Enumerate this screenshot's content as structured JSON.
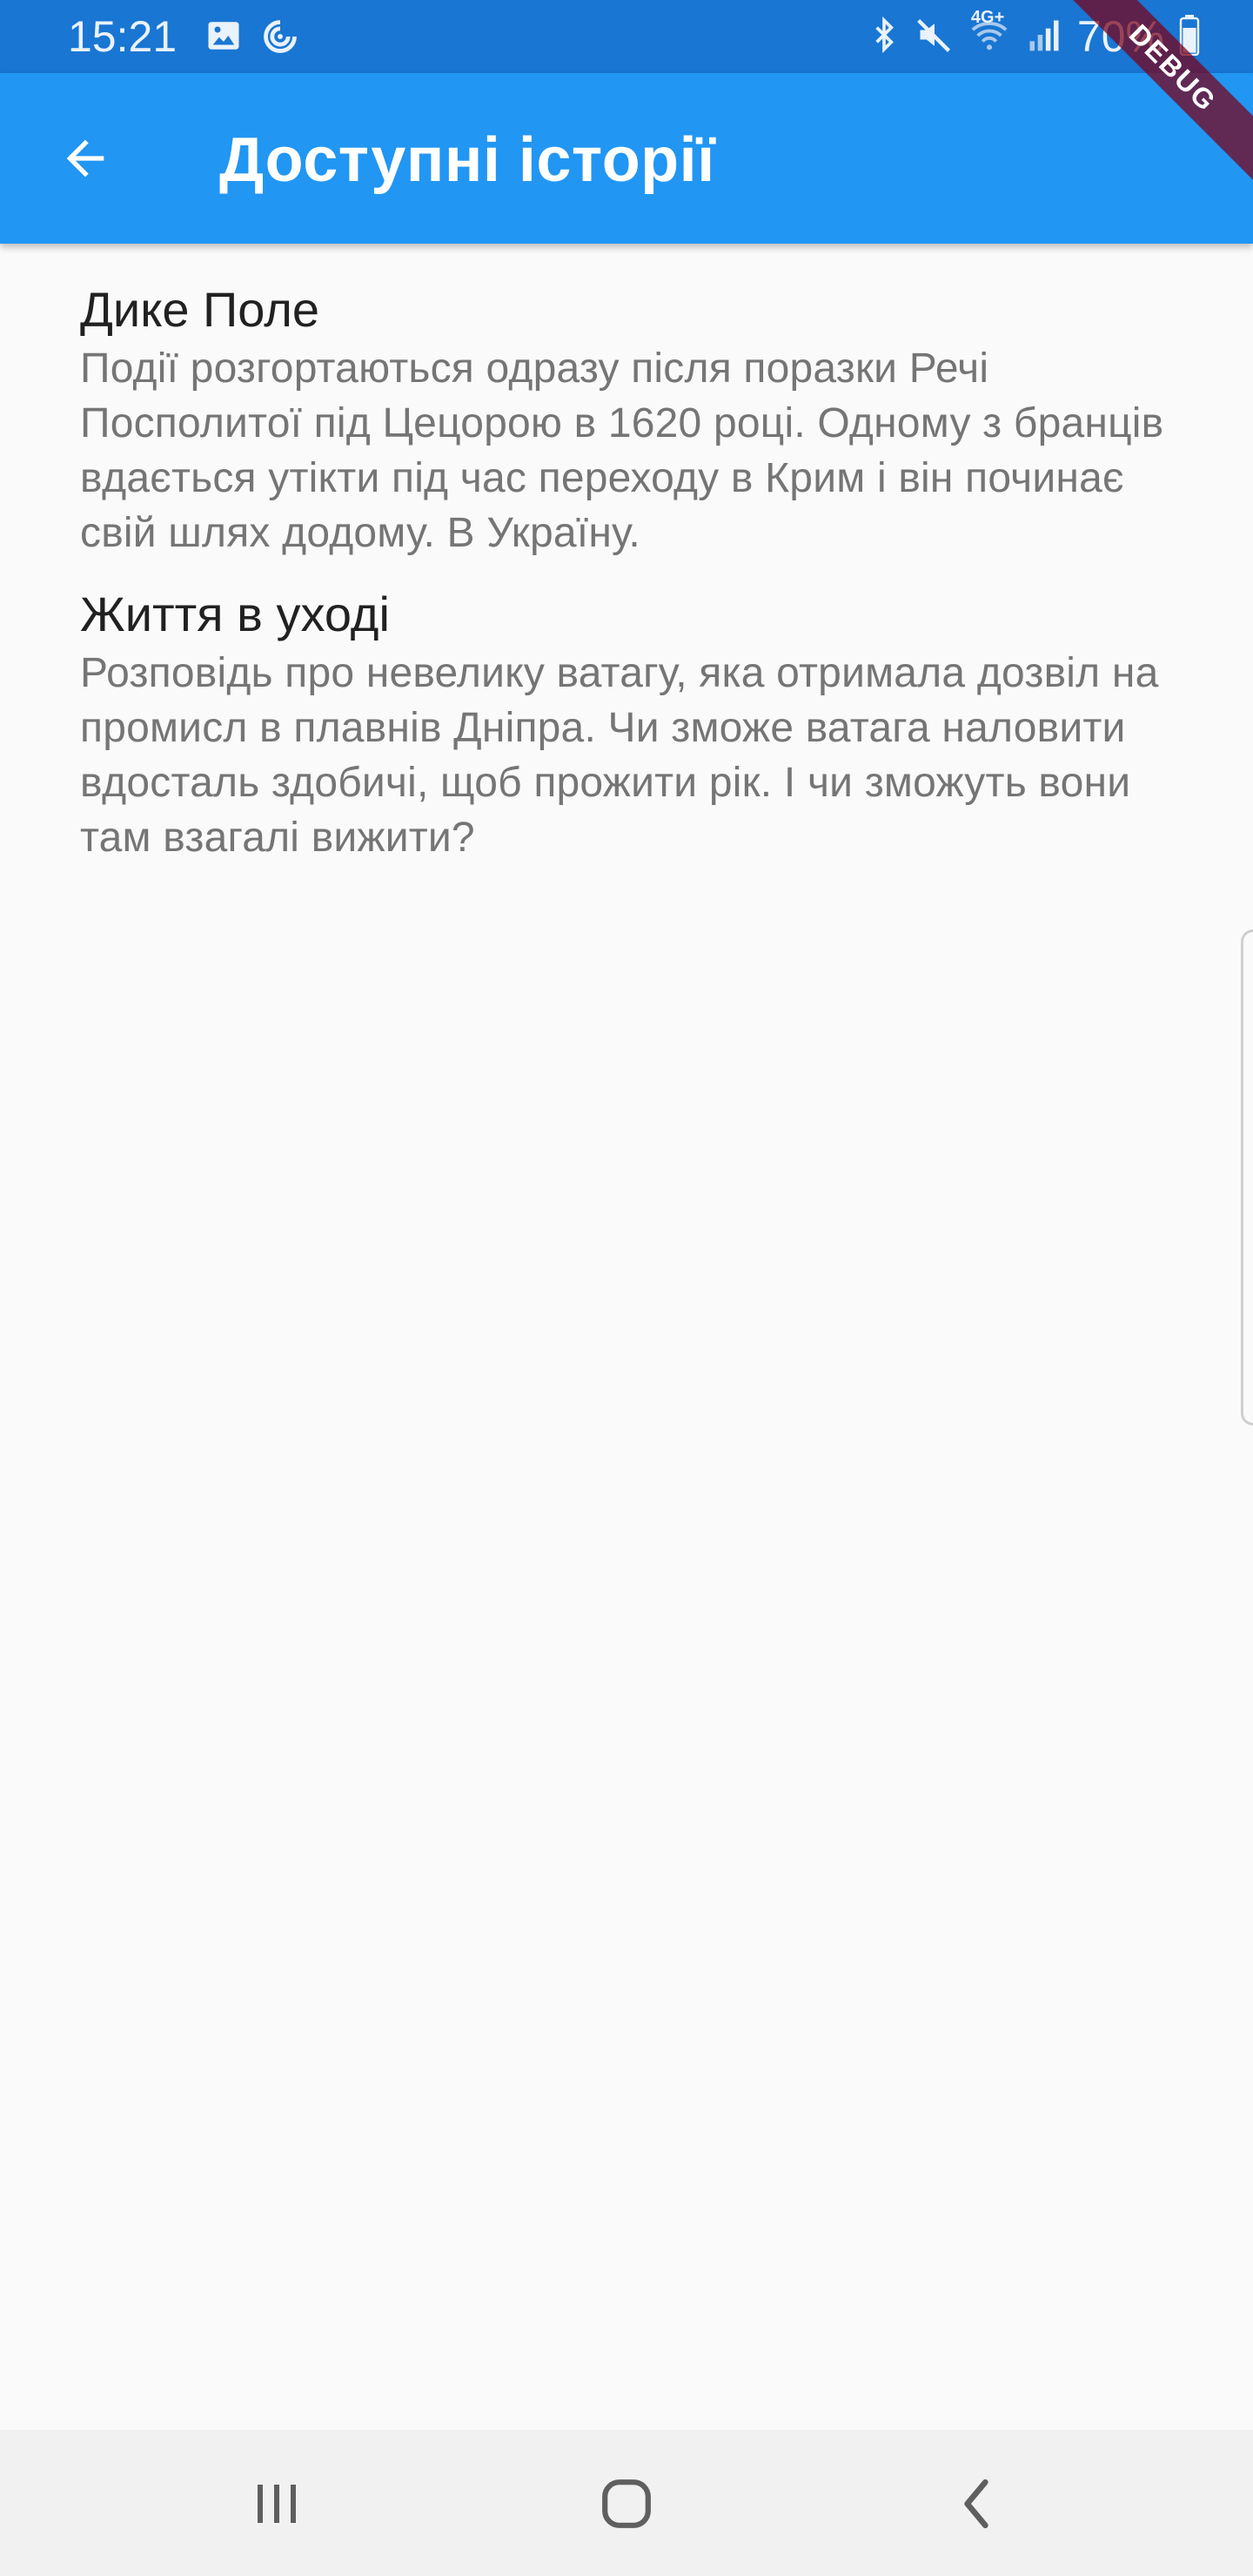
{
  "status_bar": {
    "time": "15:21",
    "battery": "70%",
    "network": "4G+",
    "left_icons": [
      "image-icon",
      "sync-icon"
    ],
    "right_icons": [
      "bluetooth-icon",
      "mute-icon",
      "wifi-icon",
      "signal-icon",
      "battery-icon"
    ]
  },
  "app_bar": {
    "title": "Доступні історії",
    "back_icon": "arrow-back-icon",
    "color": "#2196f3"
  },
  "debug_banner": "DEBUG",
  "stories": [
    {
      "title": "Дике Поле",
      "description": "Події розгортаються одразу після поразки Речі Посполитої під Цецорою в 1620 році. Одному з бранців вдається утікти під час переходу в Крим і він починає свій шлях додому. В Україну."
    },
    {
      "title": "Життя в уході",
      "description": "Розповідь про невелику ватагу, яка отримала дозвіл на промисл в плавнів Дніпра. Чи зможе ватага наловити вдосталь здобичі, щоб прожити рік. І чи зможуть вони там взагалі вижити?"
    }
  ],
  "nav_bar": {
    "recents_icon": "recents-icon",
    "home_icon": "home-icon",
    "back_icon": "nav-back-icon"
  }
}
